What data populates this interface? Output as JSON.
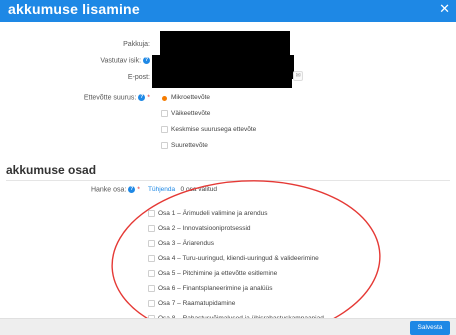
{
  "window": {
    "title": "akkumuse lisamine",
    "close_label": "✕"
  },
  "form": {
    "pakkuja_label": "Pakkuja:",
    "vastutav_label": "Vastutav isik:",
    "email_label": "E-post:",
    "size_label": "Ettevõtte suurus:",
    "size_options": [
      "Mikroettevõte",
      "Väikeettevõte",
      "Keskmise suurusega ettevõte",
      "Suurettevõte"
    ],
    "size_selected": "Mikroettevõte"
  },
  "section": {
    "title": "akkumuse osad",
    "hanke_label": "Hanke osa:",
    "clear_label": "Tühjenda",
    "count_text": "0 osa valitud",
    "parts": [
      "Osa 1 – Ärimudeli valimine ja arendus",
      "Osa 2 – Innovatsiooniprotsessid",
      "Osa 3 – Äriarendus",
      "Osa 4 – Turu-uuringud, kliendi-uuringud & valideerimine",
      "Osa 5 – Pitchimine ja ettevõtte esitlemine",
      "Osa 6 – Finantsplaneerimine ja analüüs",
      "Osa 7 – Raamatupidamine",
      "Osa 8 – Rahastusvõimalused ja ühisrahastuskampaaniad"
    ]
  },
  "footer": {
    "save_label": "Salvesta"
  },
  "colors": {
    "accent": "#1e88e5",
    "radio": "#f57c00",
    "annotation": "#e53935"
  }
}
